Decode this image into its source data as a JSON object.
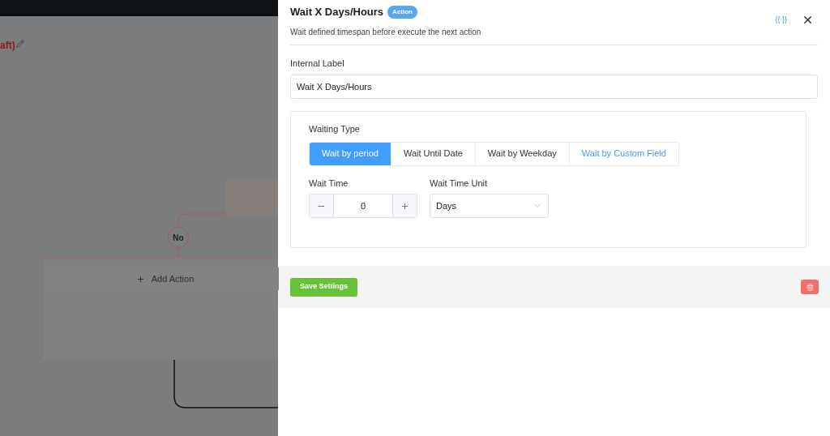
{
  "canvas": {
    "title_fragment": "aft)",
    "no_label": "No",
    "add_action": "Add Action"
  },
  "drawer": {
    "title": "Wait X Days/Hours",
    "badge": "Action",
    "subtitle": "Wait defined timespan before execute the next action",
    "code_toggle": "{{ }}",
    "internal_label": {
      "label": "Internal Label",
      "value": "Wait X Days/Hours"
    },
    "waiting_type": {
      "label": "Waiting Type",
      "tabs": [
        {
          "label": "Wait by period",
          "selected": true,
          "hovered": false
        },
        {
          "label": "Wait Until Date",
          "selected": false,
          "hovered": false
        },
        {
          "label": "Wait by Weekday",
          "selected": false,
          "hovered": false
        },
        {
          "label": "Wait by Custom Field",
          "selected": false,
          "hovered": true
        }
      ]
    },
    "wait_time": {
      "label": "Wait Time",
      "value": "0"
    },
    "wait_time_unit": {
      "label": "Wait Time Unit",
      "value": "Days"
    },
    "save_button": "Save Settings"
  }
}
